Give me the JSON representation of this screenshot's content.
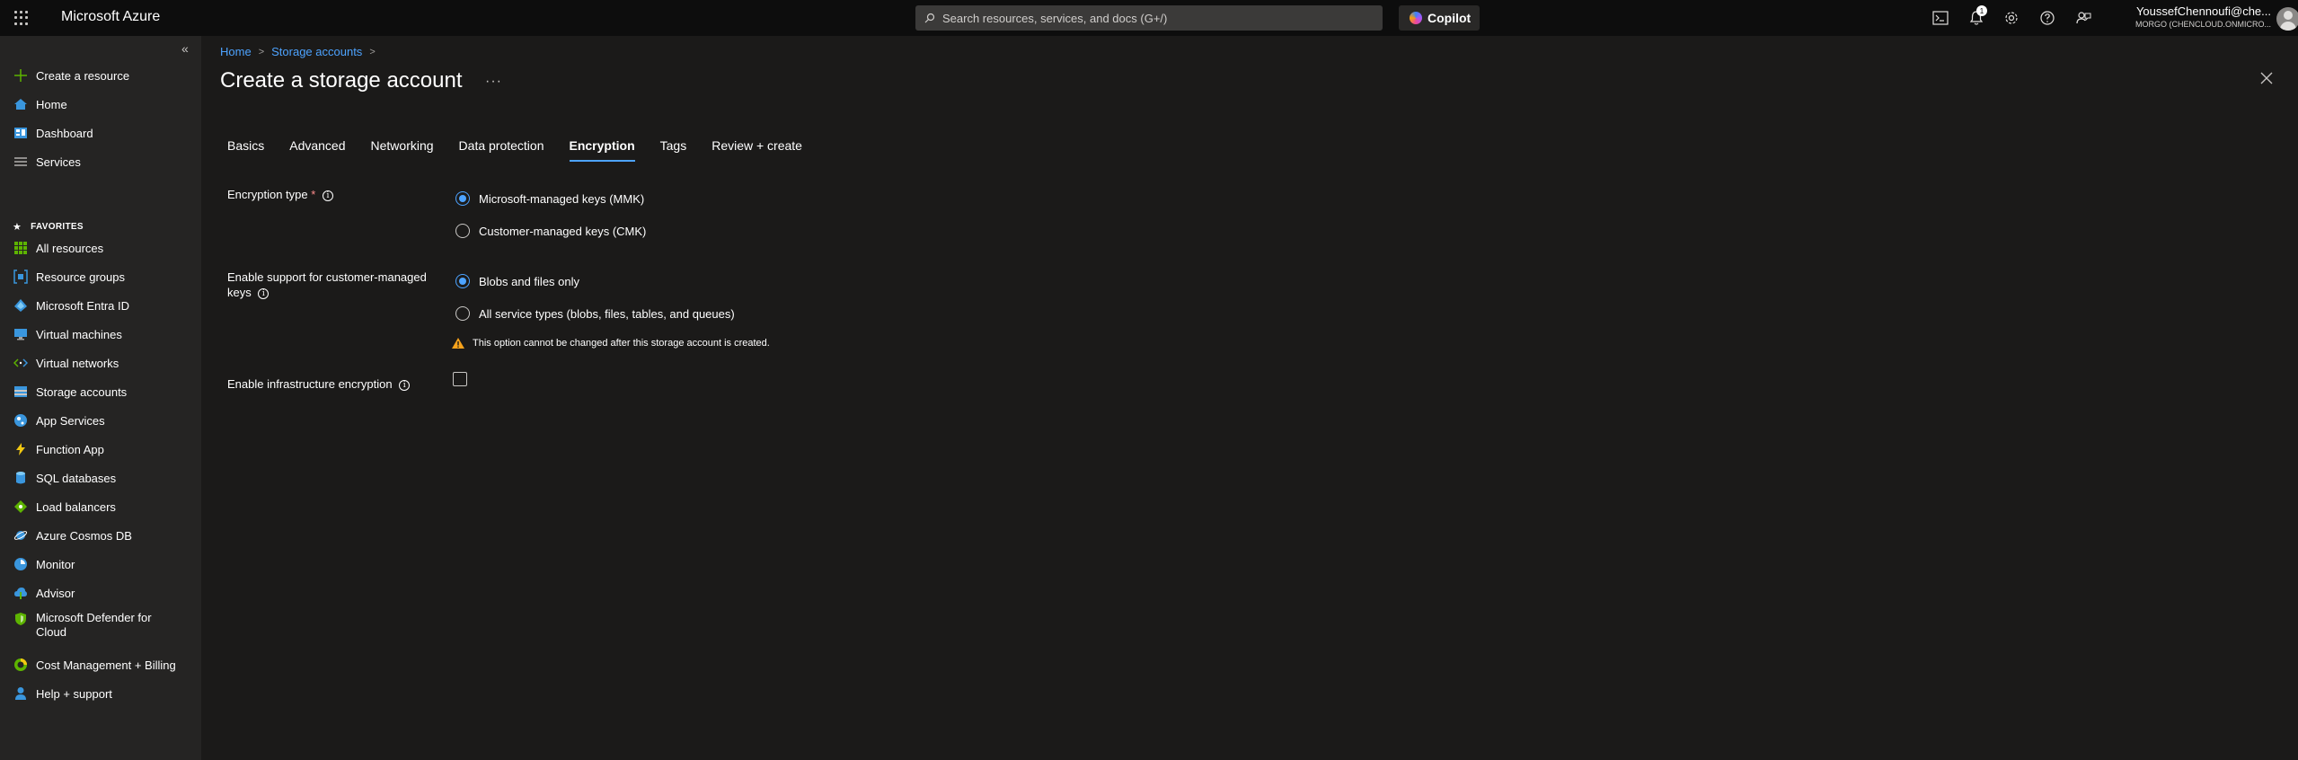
{
  "topbar": {
    "brand": "Microsoft Azure",
    "search_placeholder": "Search resources, services, and docs (G+/)",
    "copilot_label": "Copilot",
    "notification_count": "1",
    "account_user": "YoussefChennoufi@che...",
    "account_tenant": "MORGO (CHENCLOUD.ONMICRO..."
  },
  "sidebar": {
    "collapse_glyph": "«",
    "create_resource": "Create a resource",
    "home": "Home",
    "dashboard": "Dashboard",
    "services": "Services",
    "favorites_label": "FAVORITES",
    "items": [
      {
        "label": "All resources",
        "icon": "all-resources-icon",
        "color": "#5db300"
      },
      {
        "label": "Resource groups",
        "icon": "resource-groups-icon",
        "color": "#3a96dd"
      },
      {
        "label": "Microsoft Entra ID",
        "icon": "entra-id-icon",
        "color": "#3a96dd"
      },
      {
        "label": "Virtual machines",
        "icon": "virtual-machines-icon",
        "color": "#3a96dd"
      },
      {
        "label": "Virtual networks",
        "icon": "virtual-networks-icon",
        "color": "#3a96dd"
      },
      {
        "label": "Storage accounts",
        "icon": "storage-accounts-icon",
        "color": "#3a96dd"
      },
      {
        "label": "App Services",
        "icon": "app-services-icon",
        "color": "#3a96dd"
      },
      {
        "label": "Function App",
        "icon": "function-app-icon",
        "color": "#f2c811"
      },
      {
        "label": "SQL databases",
        "icon": "sql-databases-icon",
        "color": "#3a96dd"
      },
      {
        "label": "Load balancers",
        "icon": "load-balancers-icon",
        "color": "#5db300"
      },
      {
        "label": "Azure Cosmos DB",
        "icon": "cosmos-db-icon",
        "color": "#3a96dd"
      },
      {
        "label": "Monitor",
        "icon": "monitor-icon",
        "color": "#3a96dd"
      },
      {
        "label": "Advisor",
        "icon": "advisor-icon",
        "color": "#3a96dd"
      },
      {
        "label": "Microsoft Defender for Cloud",
        "icon": "defender-icon",
        "color": "#5db300"
      },
      {
        "label": "Cost Management + Billing",
        "icon": "cost-management-icon",
        "color": "#5db300"
      },
      {
        "label": "Help + support",
        "icon": "help-support-icon",
        "color": "#3a96dd"
      }
    ]
  },
  "main": {
    "breadcrumb": [
      "Home",
      "Storage accounts"
    ],
    "title": "Create a storage account",
    "more_glyph": "···",
    "tabs": [
      "Basics",
      "Advanced",
      "Networking",
      "Data protection",
      "Encryption",
      "Tags",
      "Review + create"
    ],
    "active_tab": "Encryption",
    "encryption_type": {
      "label": "Encryption type",
      "required_mark": "*",
      "options": [
        "Microsoft-managed keys (MMK)",
        "Customer-managed keys (CMK)"
      ],
      "selected": "Microsoft-managed keys (MMK)"
    },
    "cmk_support": {
      "label_line1": "Enable support for customer-managed",
      "label_line2": "keys",
      "options": [
        "Blobs and files only",
        "All service types (blobs, files, tables, and queues)"
      ],
      "selected": "Blobs and files only",
      "warning": "This option cannot be changed after this storage account is created."
    },
    "infra_encryption": {
      "label": "Enable infrastructure encryption",
      "checked": false
    }
  }
}
